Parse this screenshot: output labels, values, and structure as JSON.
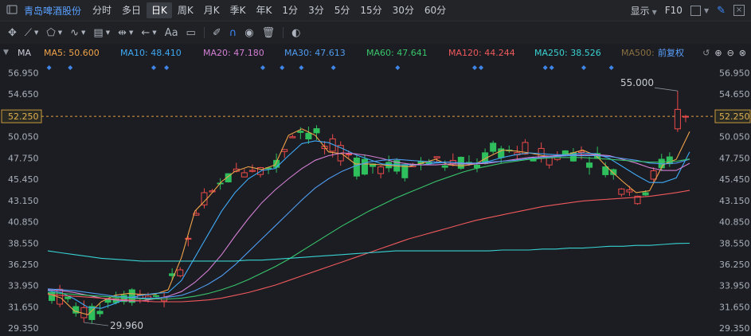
{
  "header": {
    "stock_name": "青岛啤酒股份",
    "periods": [
      "分时",
      "多日",
      "日K",
      "周K",
      "月K",
      "季K",
      "年K",
      "1分",
      "3分",
      "5分",
      "15分",
      "30分",
      "60分"
    ],
    "active_period": "日K",
    "display_label": "显示",
    "f10_label": "F10"
  },
  "toolbar": {
    "font_label": "Aa"
  },
  "ma_bar": {
    "prefix": "MA",
    "items": [
      {
        "label": "MA5: 50.600",
        "color": "#f0a34a"
      },
      {
        "label": "MA10: 48.410",
        "color": "#3fa9f5"
      },
      {
        "label": "MA20: 47.180",
        "color": "#d47fd4"
      },
      {
        "label": "MA30: 47.613",
        "color": "#4f9cf0"
      },
      {
        "label": "MA60: 47.641",
        "color": "#38c46a"
      },
      {
        "label": "MA120: 44.244",
        "color": "#f0595c"
      },
      {
        "label": "MA250: 38.526",
        "color": "#39d2d2"
      },
      {
        "label": "MA500:",
        "color": "#8a7040"
      }
    ],
    "adjust_label": "前复权"
  },
  "chart_data": {
    "type": "candlestick",
    "ylim": [
      28.5,
      58.2
    ],
    "y_ticks": [
      "56.950",
      "54.650",
      "52.250",
      "50.050",
      "47.750",
      "45.450",
      "43.150",
      "40.850",
      "38.550",
      "36.250",
      "33.950",
      "31.650",
      "29.350"
    ],
    "current_price_label": "52.250",
    "current_price": 52.25,
    "high_annotation": "55.000",
    "high_value": 55.0,
    "low_annotation": "29.960",
    "low_value": 29.96,
    "bull_color": "#ec4a4a",
    "bear_color": "#2fbf5d",
    "candle_count": 80,
    "ma_series": [
      {
        "name": "MA5",
        "color": "#f0a34a",
        "values": [
          33.1,
          32.6,
          31.2,
          30.8,
          32.2,
          32.9,
          33.1,
          33.0,
          33.0,
          33.5,
          37.0,
          42.0,
          43.5,
          45.2,
          46.3,
          46.8,
          46.5,
          47.0,
          50.2,
          50.9,
          50.2,
          48.4,
          48.2,
          47.1,
          47.1,
          47.0,
          46.9,
          46.8,
          47.2,
          47.6,
          47.0,
          46.9,
          47.1,
          47.9,
          48.6,
          48.5,
          48.3,
          48.0,
          47.9,
          48.2,
          48.6,
          48.0,
          46.5,
          45.2,
          44.0,
          44.2,
          47.0,
          47.6,
          50.6
        ]
      },
      {
        "name": "MA10",
        "color": "#3fa9f5",
        "values": [
          33.4,
          33.2,
          32.5,
          31.6,
          31.5,
          32.0,
          32.6,
          32.9,
          33.1,
          33.2,
          34.5,
          37.0,
          39.5,
          42.0,
          44.0,
          45.5,
          46.4,
          46.6,
          48.0,
          49.3,
          49.6,
          49.4,
          48.8,
          48.1,
          47.6,
          47.1,
          47.0,
          47.0,
          47.0,
          47.2,
          47.3,
          47.2,
          47.1,
          47.4,
          47.8,
          48.1,
          48.3,
          48.2,
          48.1,
          48.1,
          48.3,
          48.2,
          47.7,
          46.8,
          45.9,
          45.1,
          45.1,
          45.6,
          48.41
        ]
      },
      {
        "name": "MA20",
        "color": "#d47fd4",
        "values": [
          33.5,
          33.4,
          33.2,
          32.9,
          32.6,
          32.4,
          32.3,
          32.3,
          32.5,
          32.8,
          33.3,
          34.3,
          35.6,
          37.3,
          39.3,
          41.2,
          42.9,
          44.3,
          45.5,
          46.6,
          47.5,
          48.0,
          48.3,
          48.2,
          48.0,
          47.7,
          47.3,
          47.1,
          47.0,
          47.0,
          47.1,
          47.1,
          47.1,
          47.2,
          47.4,
          47.6,
          47.8,
          47.9,
          48.0,
          48.0,
          48.1,
          48.1,
          48.0,
          47.6,
          47.2,
          46.7,
          46.4,
          46.4,
          47.18
        ]
      },
      {
        "name": "MA30",
        "color": "#4f9cf0",
        "values": [
          33.6,
          33.5,
          33.4,
          33.2,
          33.0,
          32.8,
          32.7,
          32.6,
          32.6,
          32.7,
          32.9,
          33.4,
          34.1,
          35.0,
          36.2,
          37.6,
          39.0,
          40.4,
          41.8,
          43.2,
          44.5,
          45.5,
          46.3,
          46.9,
          47.3,
          47.5,
          47.6,
          47.5,
          47.4,
          47.3,
          47.3,
          47.2,
          47.2,
          47.3,
          47.4,
          47.5,
          47.7,
          47.8,
          47.9,
          48.0,
          48.0,
          48.0,
          47.9,
          47.7,
          47.5,
          47.2,
          47.1,
          47.2,
          47.613
        ]
      },
      {
        "name": "MA60",
        "color": "#38c46a",
        "values": [
          33.2,
          33.1,
          33.0,
          32.9,
          32.8,
          32.7,
          32.6,
          32.5,
          32.5,
          32.5,
          32.6,
          32.8,
          33.1,
          33.5,
          34.0,
          34.6,
          35.3,
          36.0,
          36.8,
          37.7,
          38.6,
          39.5,
          40.4,
          41.2,
          42.0,
          42.7,
          43.4,
          44.0,
          44.6,
          45.2,
          45.7,
          46.2,
          46.6,
          46.9,
          47.2,
          47.4,
          47.6,
          47.7,
          47.8,
          47.8,
          47.8,
          47.7,
          47.6,
          47.5,
          47.4,
          47.3,
          47.3,
          47.4,
          47.641
        ]
      },
      {
        "name": "MA120",
        "color": "#f0595c",
        "values": [
          33.0,
          32.9,
          32.8,
          32.7,
          32.6,
          32.5,
          32.4,
          32.3,
          32.2,
          32.2,
          32.2,
          32.3,
          32.4,
          32.6,
          32.9,
          33.2,
          33.6,
          34.0,
          34.5,
          35.0,
          35.5,
          36.0,
          36.5,
          37.0,
          37.5,
          38.0,
          38.5,
          39.0,
          39.4,
          39.8,
          40.2,
          40.6,
          41.0,
          41.3,
          41.6,
          41.9,
          42.2,
          42.5,
          42.7,
          42.9,
          43.1,
          43.2,
          43.3,
          43.4,
          43.5,
          43.6,
          43.8,
          44.0,
          44.244
        ]
      },
      {
        "name": "MA250",
        "color": "#39d2d2",
        "values": [
          37.7,
          37.5,
          37.3,
          37.1,
          36.9,
          36.8,
          36.7,
          36.6,
          36.6,
          36.6,
          36.6,
          36.6,
          36.6,
          36.6,
          36.6,
          36.7,
          36.7,
          36.8,
          36.9,
          37.0,
          37.1,
          37.2,
          37.3,
          37.4,
          37.5,
          37.6,
          37.7,
          37.7,
          37.7,
          37.7,
          37.7,
          37.7,
          37.7,
          37.7,
          37.8,
          37.8,
          37.8,
          37.9,
          37.9,
          38.0,
          38.0,
          38.1,
          38.2,
          38.2,
          38.3,
          38.3,
          38.4,
          38.5,
          38.526
        ]
      }
    ]
  }
}
